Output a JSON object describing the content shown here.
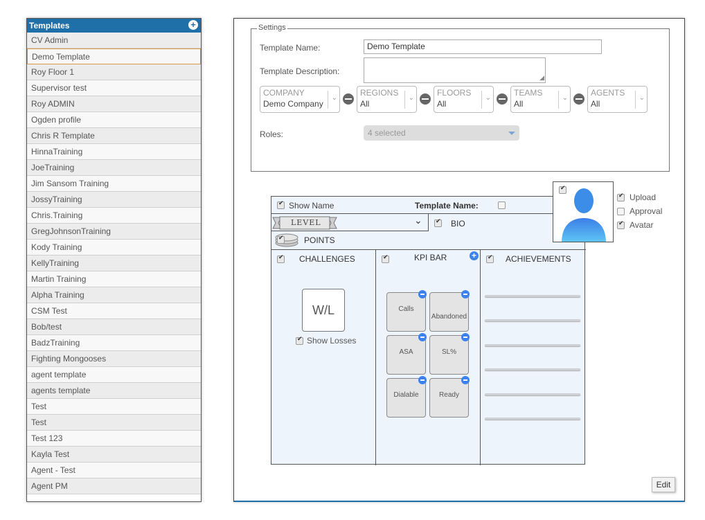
{
  "templates": {
    "header": "Templates",
    "items": [
      {
        "label": "CV Admin"
      },
      {
        "label": "Demo Template",
        "selected": true
      },
      {
        "label": "Roy Floor 1"
      },
      {
        "label": "Supervisor test"
      },
      {
        "label": "Roy ADMIN"
      },
      {
        "label": "Ogden profile"
      },
      {
        "label": "Chris R Template"
      },
      {
        "label": "HinnaTraining"
      },
      {
        "label": "JoeTraining"
      },
      {
        "label": "Jim Sansom Training"
      },
      {
        "label": "JossyTraining"
      },
      {
        "label": "Chris.Training"
      },
      {
        "label": "GregJohnsonTraining"
      },
      {
        "label": "Kody Training"
      },
      {
        "label": "KellyTraining"
      },
      {
        "label": "Martin Training"
      },
      {
        "label": "Alpha Training"
      },
      {
        "label": "CSM Test"
      },
      {
        "label": "Bob/test"
      },
      {
        "label": "BadzTraining"
      },
      {
        "label": "Fighting Mongooses"
      },
      {
        "label": "agent template"
      },
      {
        "label": "agents template"
      },
      {
        "label": "Test"
      },
      {
        "label": "Test"
      },
      {
        "label": "Test 123"
      },
      {
        "label": "Kayla Test"
      },
      {
        "label": "Agent - Test"
      },
      {
        "label": "Agent PM"
      }
    ]
  },
  "settings": {
    "legend": "Settings",
    "name_label": "Template Name:",
    "name_value": "Demo Template",
    "desc_label": "Template Description:",
    "desc_value": "",
    "filters": [
      {
        "title": "COMPANY",
        "value": "Demo Company"
      },
      {
        "title": "REGIONS",
        "value": "All"
      },
      {
        "title": "FLOORS",
        "value": "All"
      },
      {
        "title": "TEAMS",
        "value": "All"
      },
      {
        "title": "AGENTS",
        "value": "All"
      }
    ],
    "roles_label": "Roles:",
    "roles_value": "4 selected"
  },
  "preview": {
    "show_name": "Show Name",
    "template_name": "Template Name:",
    "level": "LEVEL",
    "bio": "BIO",
    "points": "POINTS",
    "challenges": "CHALLENGES",
    "wl": "W/L",
    "show_losses": "Show Losses",
    "kpi_bar": "KPI BAR",
    "kpis": [
      "Calls",
      "Abandoned",
      "ASA",
      "SL%",
      "Dialable",
      "Ready"
    ],
    "achievements": "ACHIEVEMENTS",
    "upload": "Upload",
    "approval": "Approval",
    "avatar": "Avatar"
  },
  "edit_label": "Edit",
  "colors": {
    "accent": "#1f6fa8",
    "selected_border": "#d99a3d",
    "kpi_icon": "#3b82f0",
    "avatar": "#3b8de8"
  }
}
